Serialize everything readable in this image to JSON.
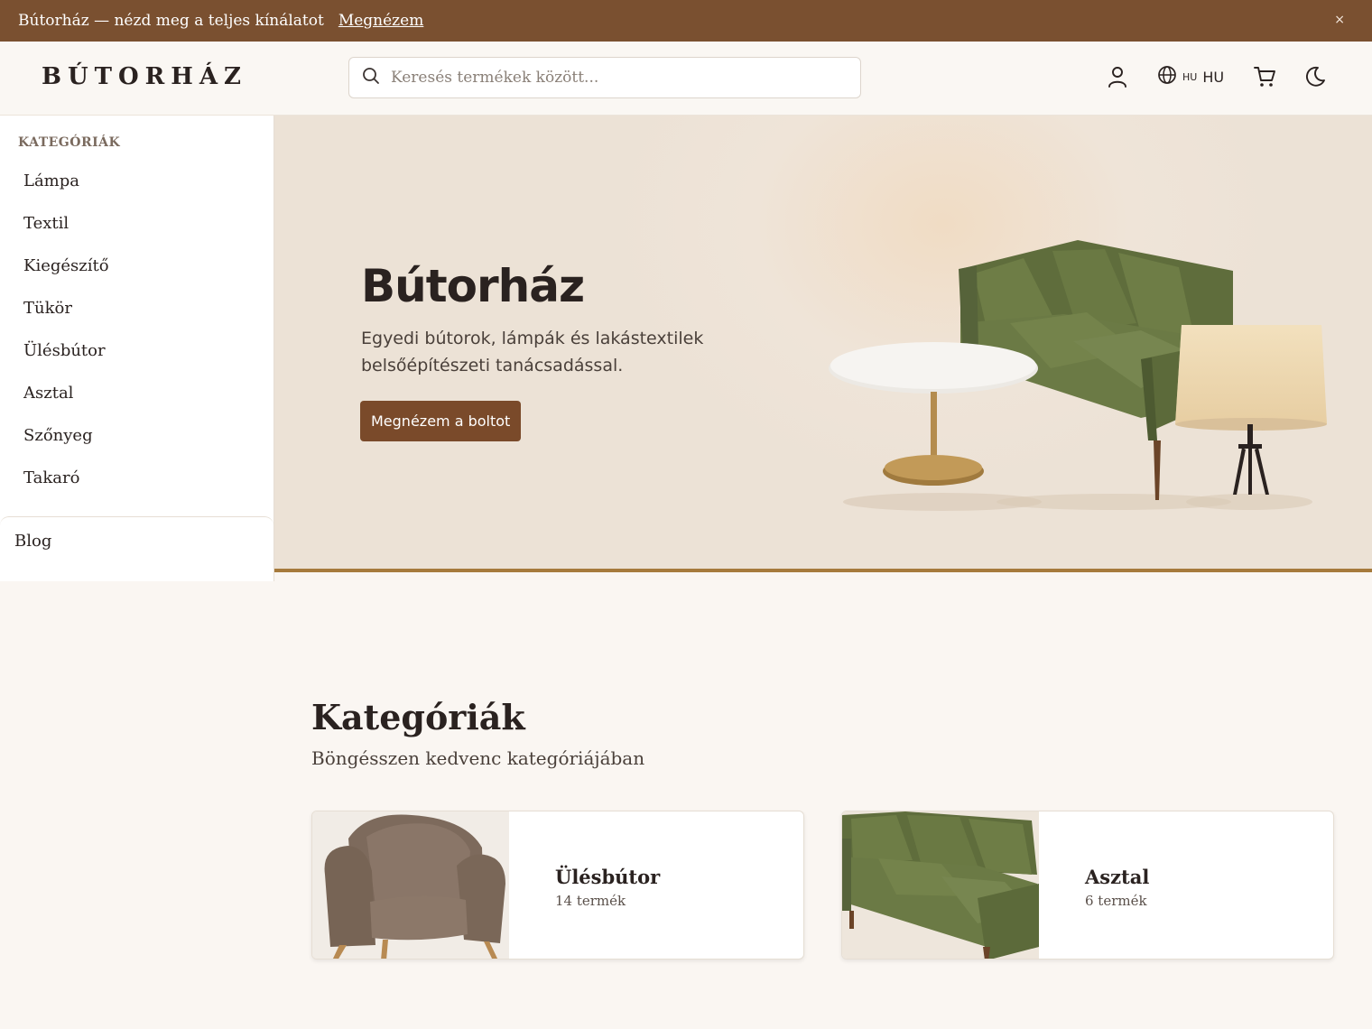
{
  "announcement": {
    "message": "Bútorház — nézd meg a teljes kínálatot",
    "link": "Megnézem",
    "close": "×"
  },
  "header": {
    "logo": "BÚTORHÁZ",
    "search_placeholder": "Keresés termékek között...",
    "lang_small": "HU",
    "lang_big": "HU",
    "icons": [
      "user-icon",
      "globe-icon",
      "cart-icon",
      "moon-icon"
    ]
  },
  "sidebar": {
    "heading": "KATEGÓRIÁK",
    "items": [
      {
        "label": "Lámpa"
      },
      {
        "label": "Textil"
      },
      {
        "label": "Kiegészítő"
      },
      {
        "label": "Tükör"
      },
      {
        "label": "Ülésbútor"
      },
      {
        "label": "Asztal"
      },
      {
        "label": "Szőnyeg"
      },
      {
        "label": "Takaró"
      }
    ],
    "blog": "Blog"
  },
  "hero": {
    "title": "Bútorház",
    "subtitle": "Egyedi bútorok, lámpák és lakástextilek belsőépítészeti tanácsadással.",
    "cta": "Megnézem a boltot"
  },
  "categories": {
    "title": "Kategóriák",
    "subtitle": "Böngésszen kedvenc kategóriájában",
    "cards": [
      {
        "name": "Ülésbútor",
        "count": "14 termék",
        "image": "armchair"
      },
      {
        "name": "Asztal",
        "count": "6 termék",
        "image": "sofa"
      }
    ]
  },
  "colors": {
    "accent": "#7a5030",
    "button": "#7a4a2a",
    "hero_border": "#a67a3c",
    "sofa_green": "#6b7a45"
  }
}
